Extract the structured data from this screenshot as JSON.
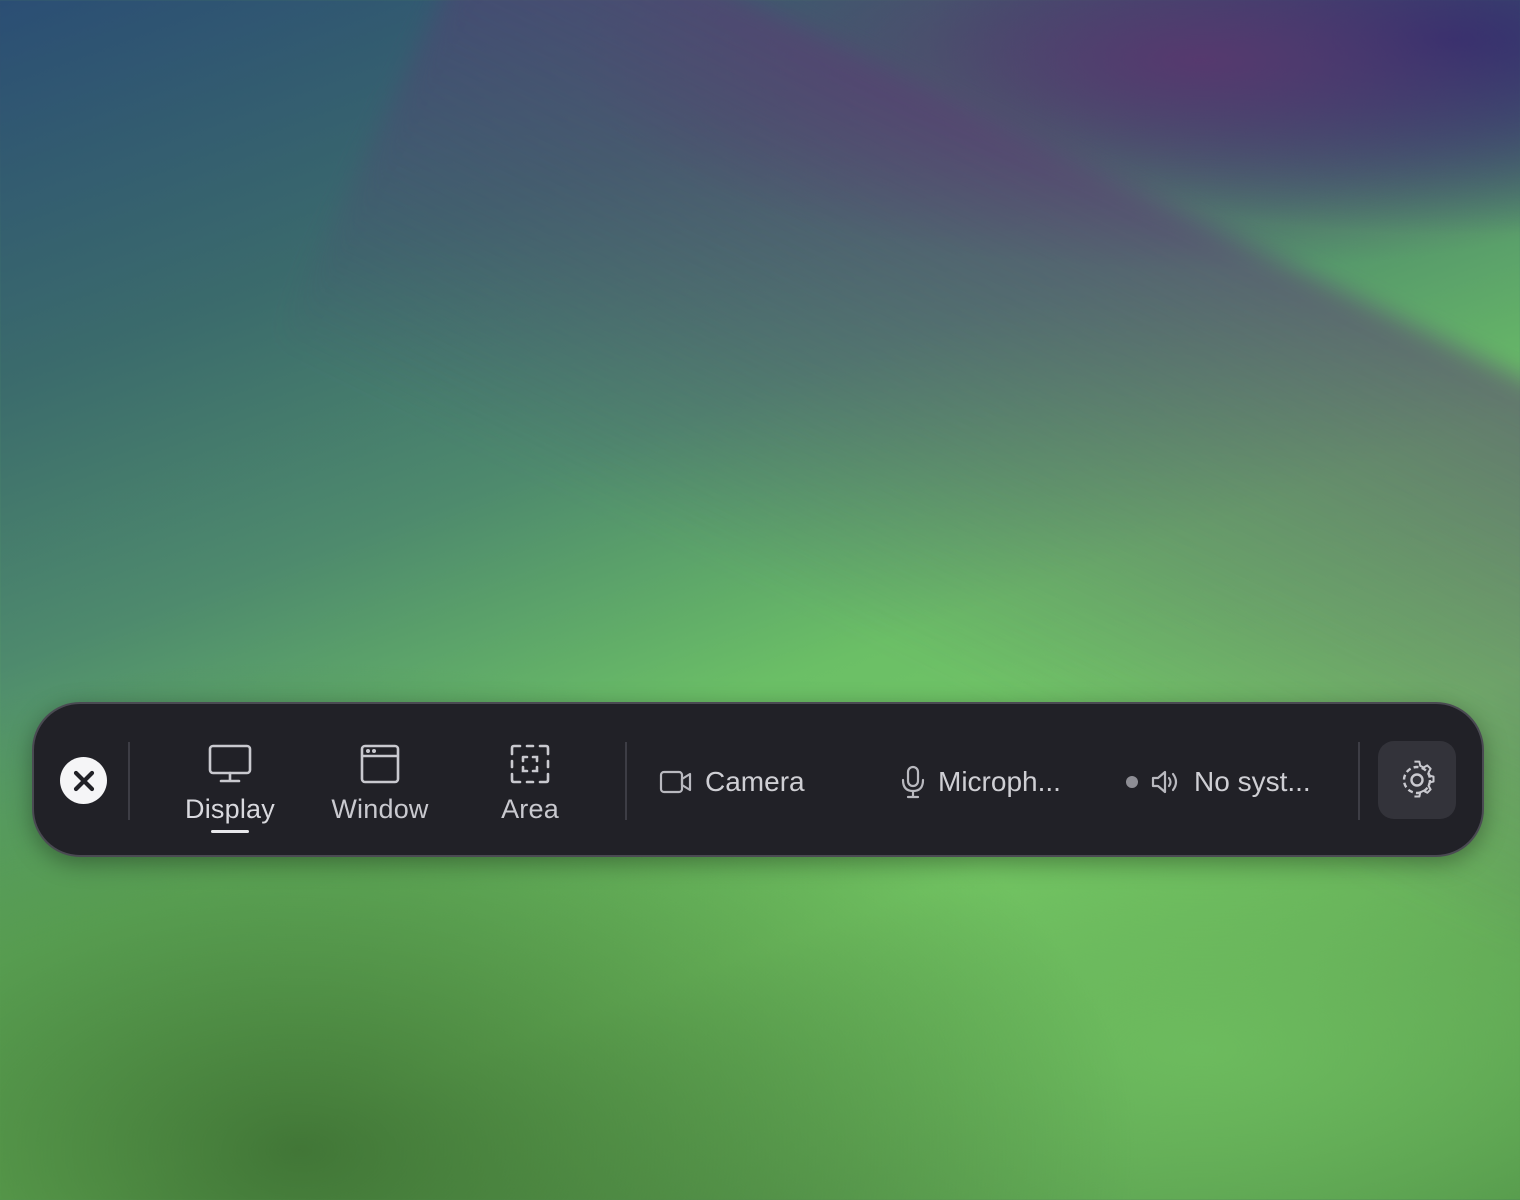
{
  "toolbar": {
    "close_icon": "close-circle-icon",
    "modes": [
      {
        "label": "Display",
        "icon": "display-icon",
        "selected": true
      },
      {
        "label": "Window",
        "icon": "window-icon",
        "selected": false
      },
      {
        "label": "Area",
        "icon": "area-selection-icon",
        "selected": false
      }
    ],
    "camera": {
      "label": "Camera",
      "icon": "camera-icon"
    },
    "microphone": {
      "label": "Microph...",
      "icon": "microphone-icon"
    },
    "system_audio": {
      "label": "No syst...",
      "icon": "speaker-icon",
      "status_dot_color": "#8e8e95"
    },
    "settings_icon": "gear-icon"
  },
  "colors": {
    "toolbar_bg": "#212127",
    "toolbar_border": "#4a4a52",
    "text": "#cfcfd4",
    "settings_bg": "#33333a"
  }
}
